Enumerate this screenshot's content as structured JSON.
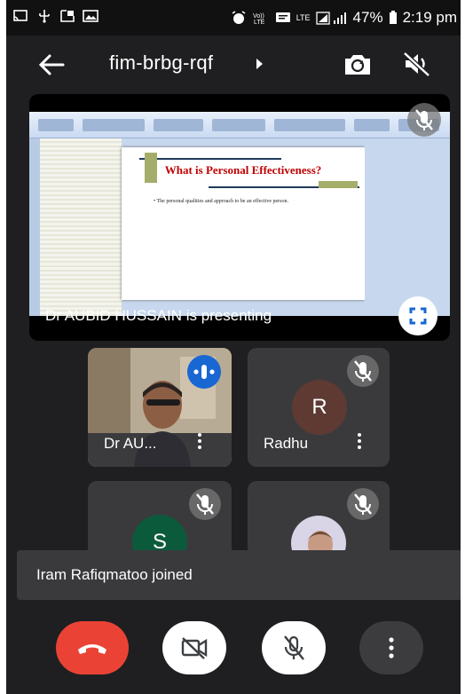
{
  "status_bar": {
    "battery": "47%",
    "time": "2:19 pm",
    "network": "LTE"
  },
  "header": {
    "meeting_code": "fim-brbg-rqf"
  },
  "presentation": {
    "presenter_text": "Dr AUBID HUSSAIN is presenting",
    "slide_title": "What is Personal Effectiveness?",
    "slide_bullet": "The personal qualities and approach to be an effective person."
  },
  "participants": [
    {
      "name": "Dr AU...",
      "state": "speaking"
    },
    {
      "name": "Radhu",
      "avatar_letter": "R",
      "avatar_color": "#5e3a33",
      "state": "muted"
    },
    {
      "name": "",
      "avatar_letter": "S",
      "avatar_color": "#0c5a3c",
      "state": "muted"
    },
    {
      "name": "",
      "state": "muted"
    }
  ],
  "toast": {
    "message": "Iram Rafiqmatoo joined"
  },
  "colors": {
    "end_call": "#ea4335",
    "speaking_badge": "#1967d2",
    "background": "#1f1f21"
  }
}
